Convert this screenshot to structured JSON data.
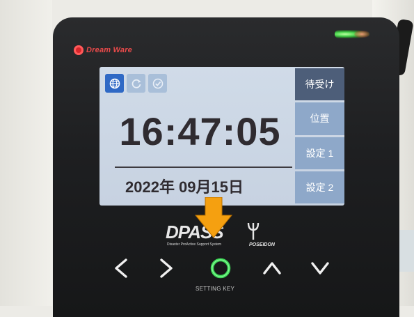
{
  "device": {
    "brand": "Dream Ware"
  },
  "screen": {
    "status_icons": [
      "globe-icon",
      "refresh-icon",
      "check-icon"
    ],
    "time": "16:47:05",
    "date": "2022年 09月15日",
    "menu": [
      {
        "label": "待受け",
        "selected": true
      },
      {
        "label": "位置",
        "selected": false
      },
      {
        "label": "設定 1",
        "selected": false
      },
      {
        "label": "設定 2",
        "selected": false
      }
    ]
  },
  "logo": {
    "main": "DPASS",
    "subtitle": "Disaster ProActive Support System",
    "product": "POSEIDON"
  },
  "keys": {
    "left": "left-key",
    "right": "right-key",
    "setting": "setting-key",
    "up": "up-key",
    "down": "down-key",
    "setting_label": "SETTING KEY"
  },
  "colors": {
    "arrow": "#f5a010",
    "led": "#45d34a",
    "ring": "#3ddc57"
  }
}
